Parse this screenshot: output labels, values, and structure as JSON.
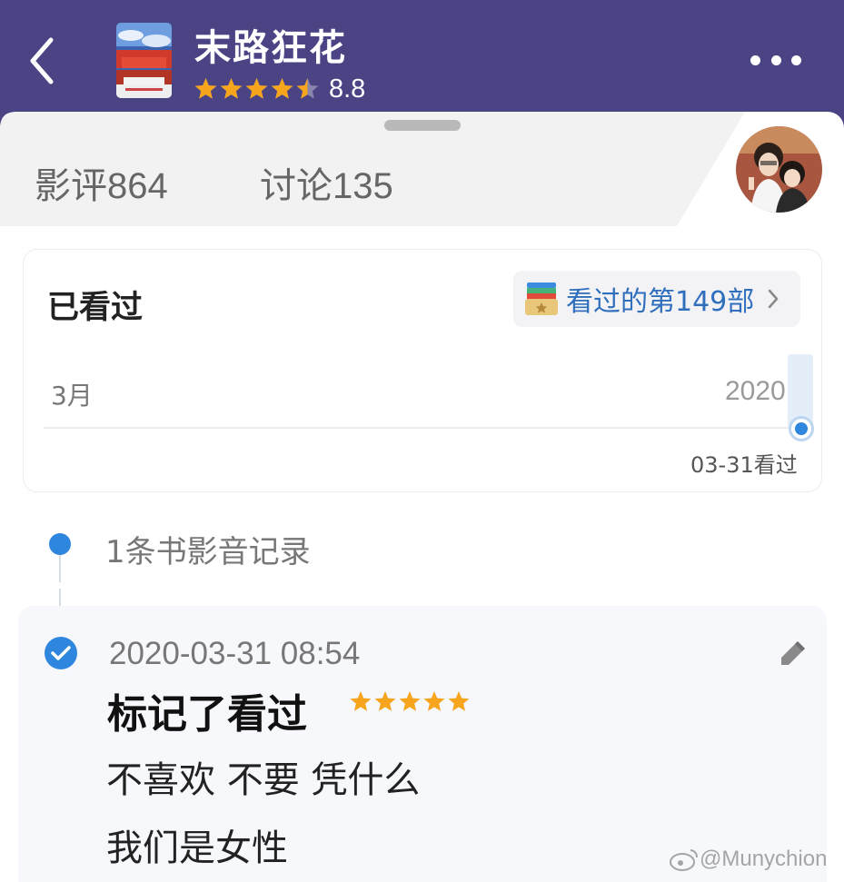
{
  "header": {
    "movie_title": "末路狂花",
    "star_rating": 4.5,
    "rating": "8.8",
    "colors": {
      "bar": "#4a4485",
      "star": "#f7a51c"
    }
  },
  "tabs": [
    {
      "label": "影评",
      "count": "864"
    },
    {
      "label": "讨论",
      "count": "135"
    }
  ],
  "watched": {
    "title": "已看过",
    "chip_label": "看过的第149部",
    "timeline": {
      "month": "3月",
      "year": "2020",
      "marker_date": "03-31看过"
    }
  },
  "records": {
    "title": "1条书影音记录",
    "entry": {
      "timestamp": "2020-03-31 08:54",
      "action": "标记了看过",
      "star_rating": 5,
      "comment_lines": [
        "不喜欢 不要 凭什么",
        "我们是女性"
      ]
    }
  },
  "watermark": "@Munychion",
  "icons": [
    "back-arrow-icon",
    "poster-thumbnail",
    "more-icon",
    "avatar",
    "shelf-icon",
    "chevron-right-icon",
    "check-circle-icon",
    "pencil-icon",
    "weibo-icon"
  ]
}
